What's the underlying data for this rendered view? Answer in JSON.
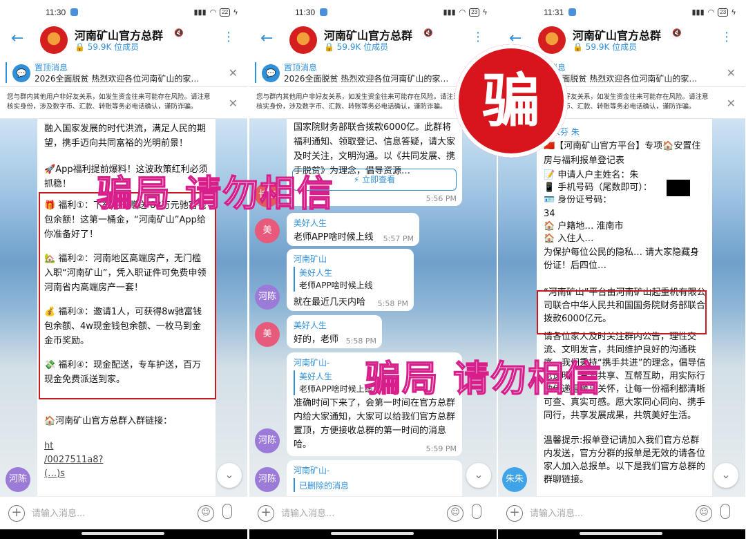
{
  "panels": [
    {
      "time": "11:30",
      "battery": "22",
      "group_title": "河南矿山官方总群",
      "members": "59.9K 位成员",
      "pinned_label": "置顶消息",
      "pinned_text": "2026全面脱贫 热烈欢迎各位河南矿山的家…",
      "warning": "您与群内其他用户非好友关系，如发生资金往来可能存在风险。请注意核实身份，涉及数字币、汇款、转账等务必电话确认，谨防诈骗。",
      "input_placeholder": "请输入消息...",
      "msg_top": "融入国家发展的时代洪流，满足人民的期望，携手迈向共同富裕的光明前景！",
      "msg_app": "🚀App福利提前爆料！这波政策红利必须抓稳！",
      "benefits": [
        "🎁 福利①：下载注册赠送 88万元驰富钱包余额！这第一桶金，“河南矿山”App给你准备好了！",
        "🏡 福利②：河南地区高端房产，无门槛入职“河南矿山”，凭入职证件可免费申领河南省内高端房产一套！",
        "💰 福利③：邀请1人，可获得8w驰富钱包余额、4w现金钱包余额、一枚马到金金币奖励。",
        "💸 福利④：现金配送，专车护送，百万现金免费派送到家。"
      ],
      "link_label": "🏠河南矿山官方总群入群链接：",
      "link_lines": [
        "ht",
        "/0027511a8?",
        "(…)s"
      ],
      "avatar_label": "河陈"
    },
    {
      "time": "11:30",
      "battery": "23",
      "group_title": "河南矿山官方总群",
      "members": "59.9K 位成员",
      "pinned_label": "置顶消息",
      "pinned_text": "2026全面脱贫 热烈欢迎各位河南矿山的家…",
      "warning": "您与群内其他用户非好友关系，如发生资金往来可能存在风险。请注意核实身份，涉及数字币、汇款、转账等务必电话确认，谨防诈骗。",
      "input_placeholder": "请输入消息...",
      "top_msg": "国家院财务部联合拨款6000亿。此群将福利通知、领取登记、信息答疑，请大家及时关注，文明沟通。以《共同发展、携手脱贫》为理念，倡导资源…",
      "top_btn": "⚡ 立即查看",
      "top_time": "5:56 PM",
      "messages": [
        {
          "avatar": "美",
          "sender": "美好人生",
          "text": "老师APP啥时候上线",
          "time": "5:57 PM"
        },
        {
          "avatar": "河陈",
          "sender": "河南矿山",
          "reply_name": "美好人生",
          "reply_text": "老师APP啥时候上线",
          "text": "就在最近几天内哈",
          "time": "5:58 PM"
        },
        {
          "avatar": "美",
          "sender": "美好人生",
          "text": "好的，老师",
          "time": "5:58 PM"
        },
        {
          "avatar": "河陈",
          "sender": "河南矿山-",
          "reply_name": "美好人生",
          "reply_text": "老师APP啥时候上线",
          "text": "准确时间下来了，会第一时间在官方总群内给大家通知，大家可以给我们官方总群置顶，方便接收总群的第一时间的消息哈。",
          "time": "5:59 PM"
        },
        {
          "avatar": "河陈",
          "sender": "河南矿山-",
          "reply_text": "已删除的消息",
          "text": ""
        }
      ],
      "side_avatar_top": "长生"
    },
    {
      "time": "11:31",
      "battery": "23",
      "group_title": "河南矿山官方总群",
      "members": "59.9K 位成员",
      "pinned_label": "置顶消息",
      "pinned_text": "2026全面脱贫 热烈欢迎各位河南矿山的家…",
      "warning": "您与群内其他用户非好友关系，如发生资金往来可能存在风险。请注意核实身份，涉及数字币、汇款、转账等务必电话确认，谨防诈骗。",
      "input_placeholder": "请输入消息...",
      "sender": "张永芬 朱",
      "form_title": "🇨🇳【河南矿山官方平台】专项🏠安置住房与福利报单登记表",
      "form_lines": [
        "📝 申请人户主姓名：朱",
        "📱 手机号码（尾数即可）：",
        "🪪 身份证号码：",
        "34",
        "🏠 户籍地… 淮南市",
        "🏠 入住人…",
        "为保护每位公民的隐私… 请大家隐藏身份证！后四位…"
      ],
      "highlight": "“河南矿山”平台由河南矿山起重机有限公司联合中华人民共和国国务院财务部联合拨款6000亿元。",
      "rest": "请各位家人及时关注群内公告，理性交流、文明发言，共同维护良好的沟通秩序。我们秉持“携手共进”的理念，倡导信息透明、资源共享、互帮互助，用实际行动传递温暖与关怀，让每一份福利都清晰可查、真实可感。愿大家同心同向、携手同行，共享发展成果，共筑美好生活。",
      "tip": "温馨提示:报单登记请加入我们官方总群内发送，官方分群的报单是无效的请各位家人加入总报单。以下是我们官方总群的群聊链接。",
      "avatar_label": "朱朱"
    }
  ],
  "watermark_1": "骗局 请勿相信",
  "watermark_2": "骗局 请勿相信",
  "stamp": "骗",
  "colors": {
    "accent": "#2f8fd8",
    "red_box": "#c8191c",
    "stamp": "#d8151c",
    "watermark_stroke": "#d81e8a"
  }
}
